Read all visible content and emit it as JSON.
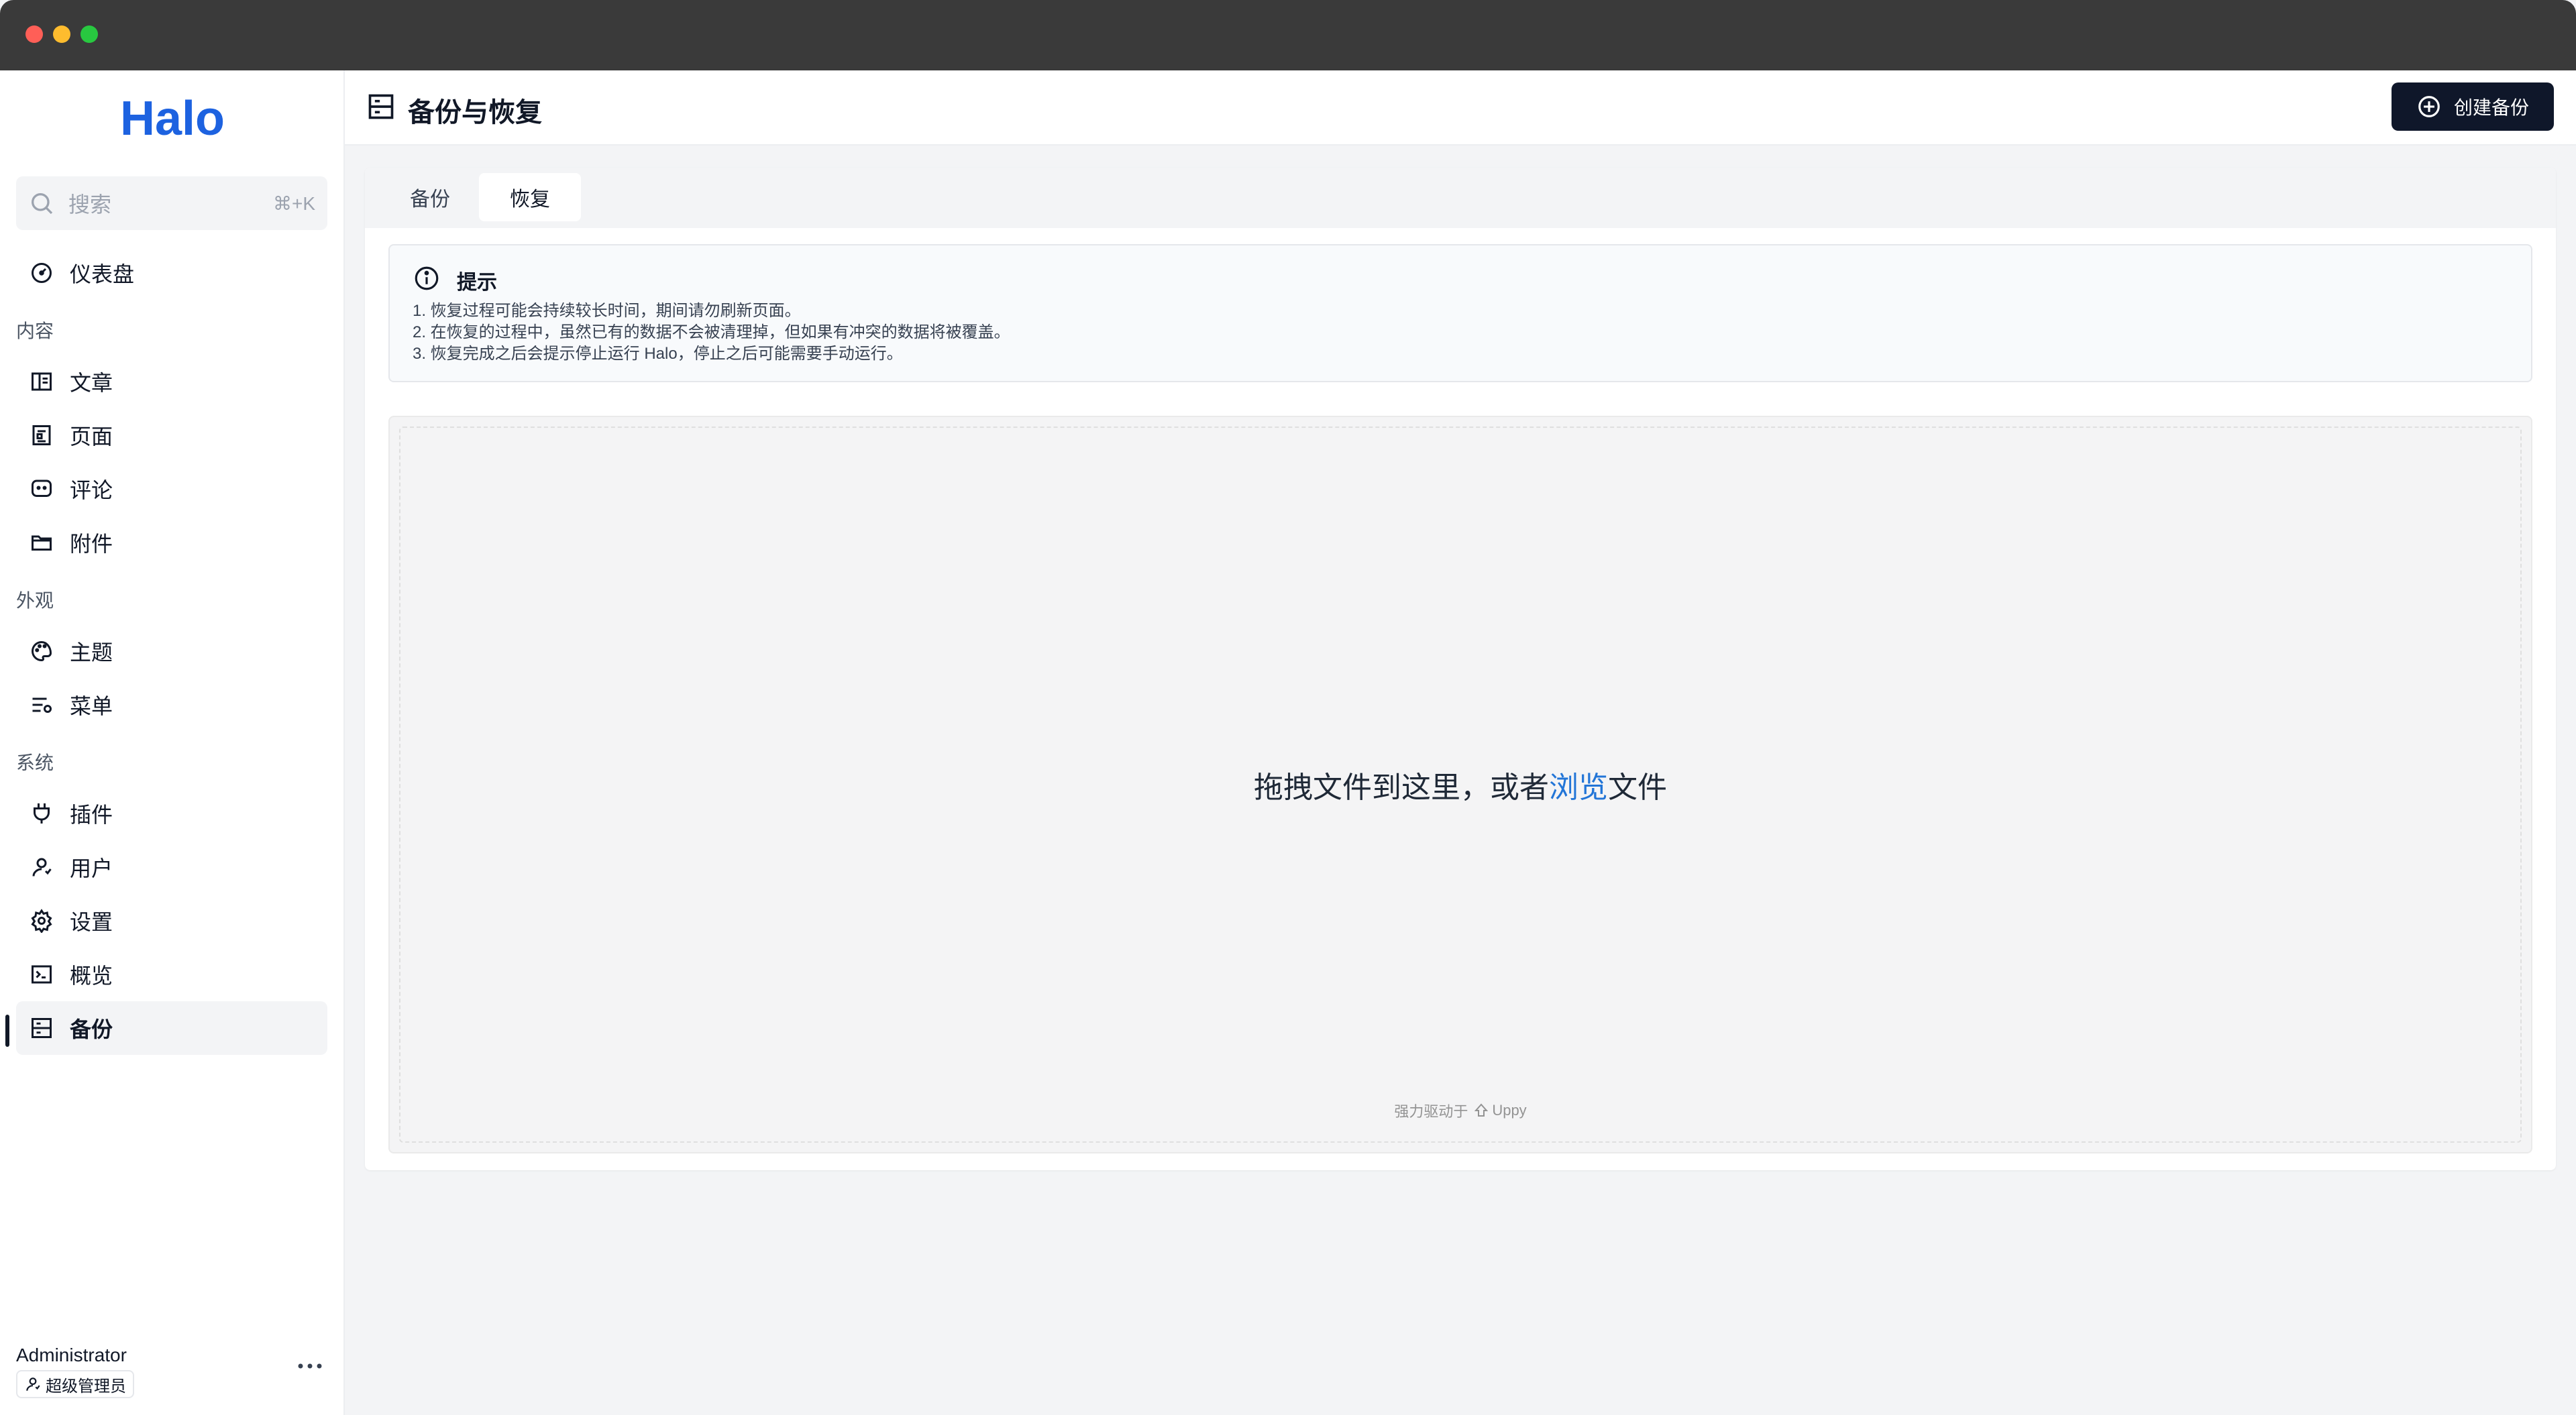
{
  "window": {
    "controls": [
      "close",
      "minimize",
      "maximize"
    ]
  },
  "sidebar": {
    "logo_text": "Halo",
    "search": {
      "placeholder": "搜索",
      "shortcut": "⌘+K"
    },
    "dashboard": {
      "label": "仪表盘",
      "icon": "dashboard-icon"
    },
    "sections": {
      "content": "内容",
      "appearance": "外观",
      "system": "系统"
    },
    "items": {
      "posts": {
        "label": "文章",
        "icon": "book-icon"
      },
      "pages": {
        "label": "页面",
        "icon": "page-icon"
      },
      "comments": {
        "label": "评论",
        "icon": "comment-icon"
      },
      "attachments": {
        "label": "附件",
        "icon": "folder-icon"
      },
      "themes": {
        "label": "主题",
        "icon": "palette-icon"
      },
      "menus": {
        "label": "菜单",
        "icon": "menu-settings-icon"
      },
      "plugins": {
        "label": "插件",
        "icon": "plug-icon"
      },
      "users": {
        "label": "用户",
        "icon": "user-icon"
      },
      "settings": {
        "label": "设置",
        "icon": "gear-icon"
      },
      "overview": {
        "label": "概览",
        "icon": "terminal-icon"
      },
      "backup": {
        "label": "备份",
        "icon": "server-icon",
        "active": true
      }
    },
    "user": {
      "name": "Administrator",
      "role": "超级管理员"
    }
  },
  "header": {
    "title": "备份与恢复",
    "create_button": "创建备份"
  },
  "tabs": [
    {
      "label": "备份",
      "active": false
    },
    {
      "label": "恢复",
      "active": true
    }
  ],
  "alert": {
    "title": "提示",
    "lines": [
      "1. 恢复过程可能会持续较长时间，期间请勿刷新页面。",
      "2. 在恢复的过程中，虽然已有的数据不会被清理掉，但如果有冲突的数据将被覆盖。",
      "3. 恢复完成之后会提示停止运行 Halo，停止之后可能需要手动运行。"
    ]
  },
  "dropzone": {
    "text_before": "拖拽文件到这里，或者",
    "link": "浏览",
    "text_after": "文件",
    "powered_by": "强力驱动于",
    "brand": "Uppy"
  },
  "colors": {
    "primary_button": "#0f172a",
    "logo_blue": "#1d62e0",
    "link_blue": "#2275d7"
  }
}
